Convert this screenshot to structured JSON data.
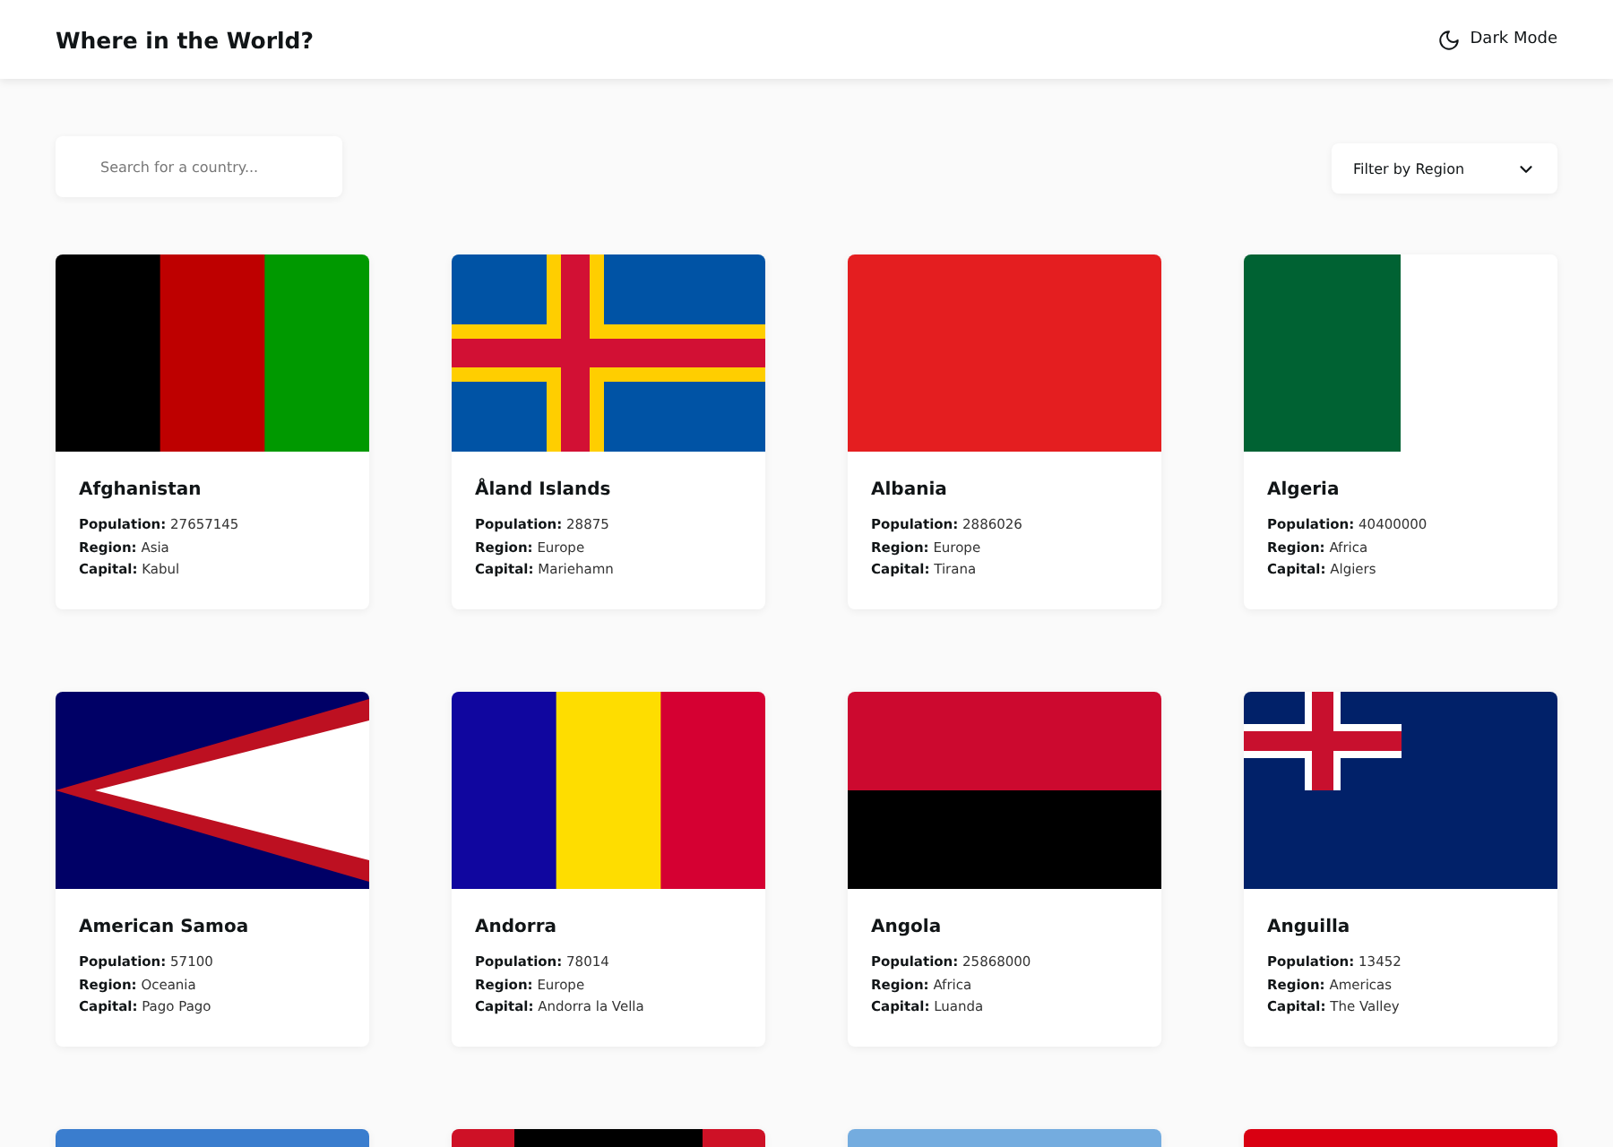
{
  "header": {
    "title": "Where in the World?",
    "theme_toggle": "Dark Mode"
  },
  "search": {
    "placeholder": "Search for a country..."
  },
  "filter": {
    "label": "Filter by Region"
  },
  "cards": [
    {
      "name": "Afghanistan",
      "details": [
        {
          "label": "Population:",
          "value": "27657145"
        },
        {
          "label": "Region:",
          "value": "Asia"
        },
        {
          "label": "Capital:",
          "value": "Kabul"
        }
      ],
      "flag": {
        "kind": "vertical",
        "stripes": [
          {
            "color": "#000000"
          },
          {
            "color": "#be0000"
          },
          {
            "color": "#009900"
          }
        ]
      }
    },
    {
      "name": "Åland Islands",
      "details": [
        {
          "label": "Population:",
          "value": "28875"
        },
        {
          "label": "Region:",
          "value": "Europe"
        },
        {
          "label": "Capital:",
          "value": "Mariehamn"
        }
      ],
      "flag": {
        "kind": "cross",
        "stripes": [
          {
            "color": "#0053a5"
          },
          {
            "color": "#ffce00"
          },
          {
            "color": "#d21034"
          }
        ]
      }
    },
    {
      "name": "Albania",
      "details": [
        {
          "label": "Population:",
          "value": "2886026"
        },
        {
          "label": "Region:",
          "value": "Europe"
        },
        {
          "label": "Capital:",
          "value": "Tirana"
        }
      ],
      "flag": {
        "kind": "vertical",
        "stripes": [
          {
            "color": "#e41e20"
          }
        ]
      }
    },
    {
      "name": "Algeria",
      "details": [
        {
          "label": "Population:",
          "value": "40400000"
        },
        {
          "label": "Region:",
          "value": "Africa"
        },
        {
          "label": "Capital:",
          "value": "Algiers"
        }
      ],
      "flag": {
        "kind": "vertical",
        "stripes": [
          {
            "color": "#006233"
          },
          {
            "color": "#ffffff"
          }
        ]
      }
    },
    {
      "name": "American Samoa",
      "details": [
        {
          "label": "Population:",
          "value": "57100"
        },
        {
          "label": "Region:",
          "value": "Oceania"
        },
        {
          "label": "Capital:",
          "value": "Pago Pago"
        }
      ],
      "flag": {
        "kind": "triangle",
        "stripes": [
          {
            "color": "#000066"
          },
          {
            "color": "#bd1021"
          },
          {
            "color": "#ffffff"
          }
        ]
      }
    },
    {
      "name": "Andorra",
      "details": [
        {
          "label": "Population:",
          "value": "78014"
        },
        {
          "label": "Region:",
          "value": "Europe"
        },
        {
          "label": "Capital:",
          "value": "Andorra la Vella"
        }
      ],
      "flag": {
        "kind": "vertical",
        "stripes": [
          {
            "color": "#10069f"
          },
          {
            "color": "#fedd00"
          },
          {
            "color": "#d50032"
          }
        ]
      }
    },
    {
      "name": "Angola",
      "details": [
        {
          "label": "Population:",
          "value": "25868000"
        },
        {
          "label": "Region:",
          "value": "Africa"
        },
        {
          "label": "Capital:",
          "value": "Luanda"
        }
      ],
      "flag": {
        "kind": "horizontal",
        "stripes": [
          {
            "color": "#cc092f"
          },
          {
            "color": "#000000"
          }
        ]
      }
    },
    {
      "name": "Anguilla",
      "details": [
        {
          "label": "Population:",
          "value": "13452"
        },
        {
          "label": "Region:",
          "value": "Americas"
        },
        {
          "label": "Capital:",
          "value": "The Valley"
        }
      ],
      "flag": {
        "kind": "canton",
        "stripes": [
          {
            "color": "#012169"
          },
          {
            "color": "#ffffff"
          },
          {
            "color": "#c8102e"
          }
        ]
      }
    }
  ],
  "partial_cards": [
    {
      "flag": {
        "kind": "horizontal",
        "stripes": [
          {
            "color": "#3a7dce"
          }
        ]
      }
    },
    {
      "flag": {
        "kind": "vertical",
        "stripes": [
          {
            "color": "#ce1126"
          },
          {
            "color": "#000000"
          },
          {
            "color": "#000000"
          },
          {
            "color": "#000000"
          },
          {
            "color": "#ce1126"
          }
        ]
      }
    },
    {
      "flag": {
        "kind": "horizontal",
        "stripes": [
          {
            "color": "#74acdf"
          }
        ]
      }
    },
    {
      "flag": {
        "kind": "horizontal",
        "stripes": [
          {
            "color": "#d90012"
          }
        ]
      }
    }
  ]
}
